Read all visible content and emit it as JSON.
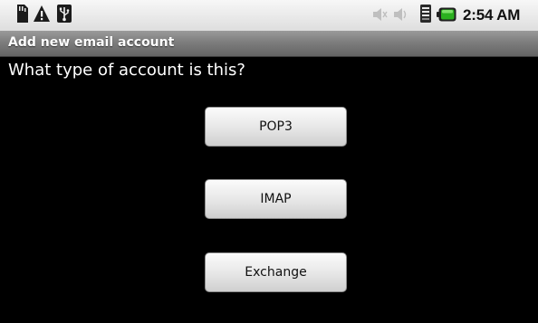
{
  "status_bar": {
    "time": "2:54 AM",
    "icons": [
      "sd-card-icon",
      "warning-icon",
      "usb-icon",
      "speaker-muted-icon",
      "speaker-icon",
      "signal-icon",
      "battery-icon"
    ],
    "battery_color": "#2bb01f"
  },
  "header": {
    "title": "Add new email account"
  },
  "main": {
    "prompt": "What type of account is this?",
    "options": [
      {
        "label": "POP3"
      },
      {
        "label": "IMAP"
      },
      {
        "label": "Exchange"
      }
    ]
  }
}
